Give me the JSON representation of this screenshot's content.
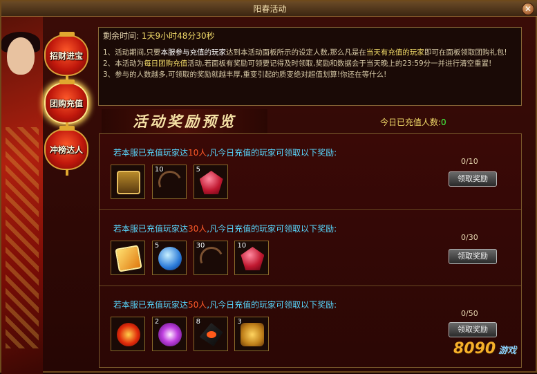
{
  "window": {
    "title": "阳春活动"
  },
  "side_tabs": [
    {
      "label": "招财进宝"
    },
    {
      "label": "团购充值"
    },
    {
      "label": "冲榜达人"
    }
  ],
  "info": {
    "time_label": "剩余时间:",
    "time_value": "1天9小时48分30秒",
    "rule1_a": "1、活动期间,只要",
    "rule1_b": "本服参与充值的玩家",
    "rule1_c": "达到本活动面板所示的设定人数,那么凡是在",
    "rule1_d": "当天有充值的玩家",
    "rule1_e": "即可在面板领取团购礼包!",
    "rule2_a": "2、本活动为",
    "rule2_b": "每日团购充值",
    "rule2_c": "活动,若面板有奖励可领要记得及时领取,奖励和数据会于当天晚上的23:59分一并进行清空重置!",
    "rule3": "3、参与的人数越多,可领取的奖励就越丰厚,重变引起的质变绝对超值划算!你还在等什么!"
  },
  "banner": {
    "title": "活动奖励预览"
  },
  "today_count": {
    "label": "今日已充值人数:",
    "value": "0"
  },
  "tiers": [
    {
      "head_a": "若本服已充值玩家达",
      "num": "10人",
      "head_b": ",凡今日充值的玩家可领取以下奖励:",
      "progress": "0/10",
      "button": "领取奖励",
      "items": [
        {
          "icon": "chest-icon",
          "qty": ""
        },
        {
          "icon": "whip-icon",
          "qty": "10"
        },
        {
          "icon": "ruby-icon",
          "qty": "5"
        }
      ]
    },
    {
      "head_a": "若本服已充值玩家达",
      "num": "30人",
      "head_b": ",凡今日充值的玩家可领取以下奖励:",
      "progress": "0/30",
      "button": "领取奖励",
      "items": [
        {
          "icon": "gold-tile-icon",
          "qty": ""
        },
        {
          "icon": "blue-orb-icon",
          "qty": "5"
        },
        {
          "icon": "whip-icon",
          "qty": "30"
        },
        {
          "icon": "ruby-icon",
          "qty": "10"
        }
      ]
    },
    {
      "head_a": "若本服已充值玩家达",
      "num": "50人",
      "head_b": ",凡今日充值的玩家可领取以下奖励:",
      "progress": "0/50",
      "button": "领取奖励",
      "items": [
        {
          "icon": "fire-swirl-icon",
          "qty": ""
        },
        {
          "icon": "purple-flower-icon",
          "qty": "2"
        },
        {
          "icon": "black-crystal-icon",
          "qty": "8"
        },
        {
          "icon": "lion-shield-icon",
          "qty": "3"
        }
      ]
    }
  ],
  "logo": {
    "text": "8090",
    "sub": "游戏"
  }
}
